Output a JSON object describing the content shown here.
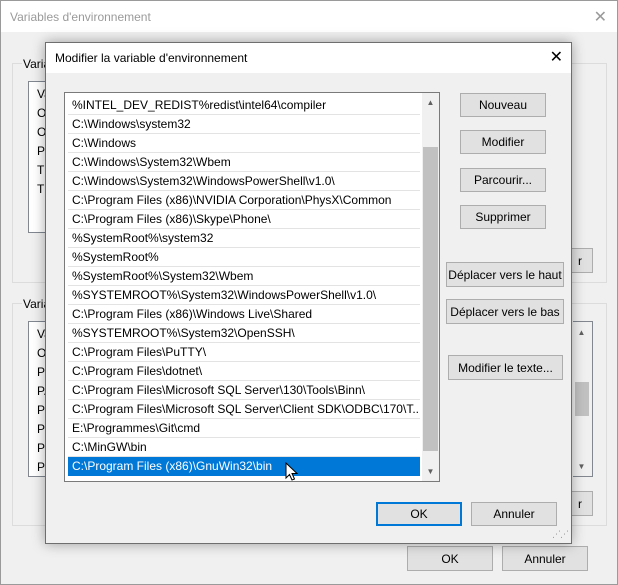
{
  "outer_window": {
    "title": "Variables d'environnement",
    "close_glyph": "✕",
    "user_group_label": "Varia",
    "user_vars": [
      "Va",
      "On",
      "On",
      "Pa",
      "TE",
      "TM"
    ],
    "system_group_label": "Varia",
    "system_vars": [
      "Va",
      "OS",
      "Pa",
      "PA",
      "PR",
      "PR",
      "PR",
      "PR"
    ],
    "hidden_button_right_glyph": "r",
    "ok_label": "OK",
    "cancel_label": "Annuler"
  },
  "dialog": {
    "title": "Modifier la variable d'environnement",
    "close_glyph": "✕",
    "paths": [
      "%INTEL_DEV_REDIST%redist\\intel64\\compiler",
      "C:\\Windows\\system32",
      "C:\\Windows",
      "C:\\Windows\\System32\\Wbem",
      "C:\\Windows\\System32\\WindowsPowerShell\\v1.0\\",
      "C:\\Program Files (x86)\\NVIDIA Corporation\\PhysX\\Common",
      "C:\\Program Files (x86)\\Skype\\Phone\\",
      "%SystemRoot%\\system32",
      "%SystemRoot%",
      "%SystemRoot%\\System32\\Wbem",
      "%SYSTEMROOT%\\System32\\WindowsPowerShell\\v1.0\\",
      "C:\\Program Files (x86)\\Windows Live\\Shared",
      "%SYSTEMROOT%\\System32\\OpenSSH\\",
      "C:\\Program Files\\PuTTY\\",
      "C:\\Program Files\\dotnet\\",
      "C:\\Program Files\\Microsoft SQL Server\\130\\Tools\\Binn\\",
      "C:\\Program Files\\Microsoft SQL Server\\Client SDK\\ODBC\\170\\T...",
      "E:\\Programmes\\Git\\cmd",
      "C:\\MinGW\\bin",
      "C:\\Program Files (x86)\\GnuWin32\\bin"
    ],
    "selected_index": 19,
    "buttons": {
      "new": "Nouveau",
      "edit": "Modifier",
      "browse": "Parcourir...",
      "delete": "Supprimer",
      "move_up": "Déplacer vers le haut",
      "move_down": "Déplacer vers le bas",
      "edit_text": "Modifier le texte...",
      "ok": "OK",
      "cancel": "Annuler"
    },
    "colors": {
      "selection": "#0078d7",
      "default_button_border": "#0078d7"
    }
  }
}
